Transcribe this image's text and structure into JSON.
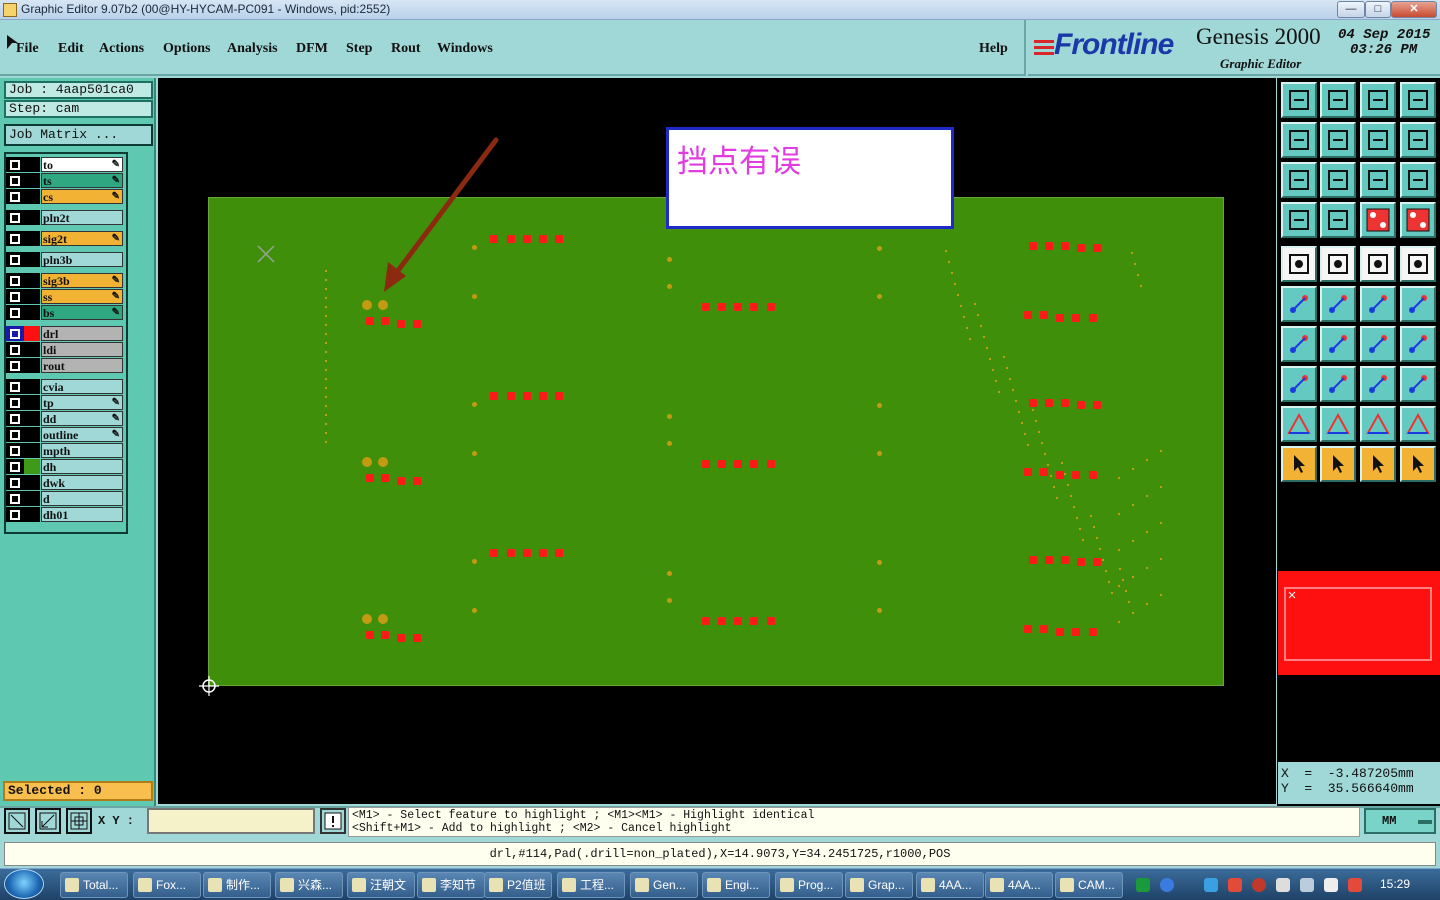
{
  "window": {
    "title": "Graphic Editor 9.07b2 (00@HY-HYCAM-PC091 - Windows, pid:2552)",
    "min": "—",
    "max": "□",
    "close": "✕"
  },
  "menu": {
    "file": "File",
    "edit": "Edit",
    "actions": "Actions",
    "options": "Options",
    "analysis": "Analysis",
    "dfm": "DFM",
    "step": "Step",
    "rout": "Rout",
    "windows": "Windows",
    "help": "Help"
  },
  "brand": {
    "logo": "Frontline",
    "product": "Genesis 2000",
    "subtitle": "Graphic Editor",
    "date": "04 Sep 2015",
    "time": "03:26 PM"
  },
  "job": {
    "job_line": "Job  : 4aap501ca0",
    "step_line": "Step: cam",
    "matrix_button": "Job Matrix ..."
  },
  "layers": [
    {
      "name": "to",
      "color": "#ffffff",
      "editable": true
    },
    {
      "name": "ts",
      "color": "#2fa882",
      "editable": true
    },
    {
      "name": "cs",
      "color": "#f2b233",
      "editable": true
    },
    {
      "name": "pln2t",
      "color": "#9fd8d6",
      "editable": false
    },
    {
      "name": "sig2t",
      "color": "#f2b233",
      "editable": true
    },
    {
      "name": "pln3b",
      "color": "#9fd8d6",
      "editable": false
    },
    {
      "name": "sig3b",
      "color": "#f2b233",
      "editable": true
    },
    {
      "name": "ss",
      "color": "#f2b233",
      "editable": true
    },
    {
      "name": "bs",
      "color": "#2fa882",
      "editable": true
    },
    {
      "name": "drl",
      "color": "#b3b3b3",
      "editable": false
    },
    {
      "name": "ldi",
      "color": "#b3b3b3",
      "editable": false
    },
    {
      "name": "rout",
      "color": "#b3b3b3",
      "editable": false
    },
    {
      "name": "cvia",
      "color": "#9fd8d6",
      "editable": false
    },
    {
      "name": "tp",
      "color": "#9fd8d6",
      "editable": true
    },
    {
      "name": "dd",
      "color": "#9fd8d6",
      "editable": true
    },
    {
      "name": "outline",
      "color": "#9fd8d6",
      "editable": true
    },
    {
      "name": "mpth",
      "color": "#9fd8d6",
      "editable": false
    },
    {
      "name": "dh",
      "color": "#9fd8d6",
      "editable": false
    },
    {
      "name": "dwk",
      "color": "#9fd8d6",
      "editable": false
    },
    {
      "name": "d",
      "color": "#9fd8d6",
      "editable": false
    },
    {
      "name": "dh01",
      "color": "#9fd8d6",
      "editable": false
    }
  ],
  "selected": "Selected : 0",
  "note": "挡点有误",
  "coords": {
    "x": "X  =  -3.487205mm",
    "y": "Y  =  35.566640mm"
  },
  "bottom": {
    "xy_label": "X Y :",
    "xy_value": "",
    "units": "MM",
    "hint1": "<M1> - Select feature to highlight ; <M1><M1> - Highlight identical",
    "hint2": "<Shift+M1> - Add to highlight ; <M2> - Cancel highlight",
    "status": "drl,#114,Pad(.drill=non_plated),X=14.9073,Y=34.2451725,r1000,POS"
  },
  "taskbar": {
    "items": [
      "Total...",
      "Fox...",
      "制作...",
      "兴森...",
      "汪朝文",
      "李知节",
      "P2值班",
      "工程...",
      "Gen...",
      "Engi...",
      "Prog...",
      "Grap...",
      "4AA...",
      "4AA...",
      "CAM..."
    ],
    "clock": "15:29"
  },
  "colors": {
    "board": "#3f8f0a",
    "pad": "#ff1a1a",
    "drill": "#c49a13",
    "panel": "#9fd8d6",
    "layer_panel": "#5ec8b0"
  }
}
